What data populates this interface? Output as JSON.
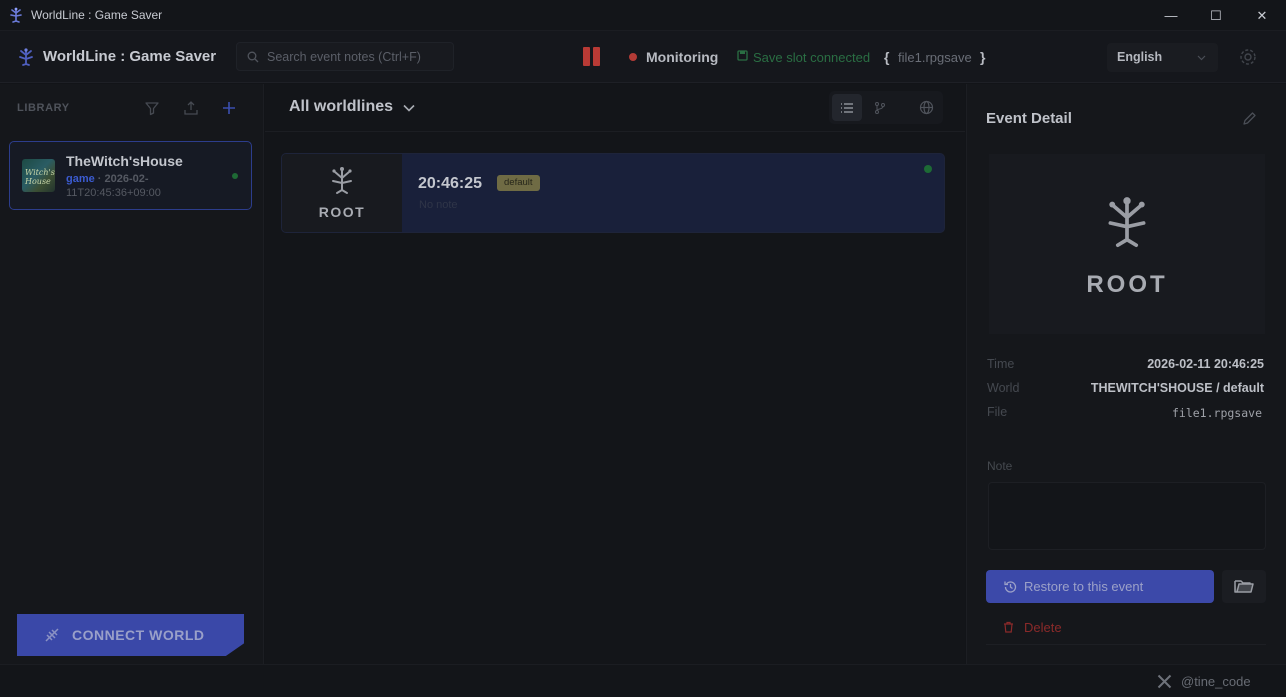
{
  "window": {
    "title": "WorldLine : Game Saver",
    "controls": {
      "minimize": "—",
      "maximize": "☐",
      "close": "✕"
    }
  },
  "header": {
    "app_name": "WorldLine : Game Saver",
    "search_placeholder": "Search event notes (Ctrl+F)",
    "monitoring_label": "Monitoring",
    "slot_status": "Save slot connected",
    "slot_brace_open": "{",
    "slot_file": "file1.rpgsave",
    "slot_brace_close": "}",
    "language": "English",
    "colors": {
      "recording": "#b33b36",
      "connected": "#2a6e43",
      "accent": "#3c49a9"
    }
  },
  "sidebar": {
    "library_label": "LIBRARY",
    "icons": [
      "filter-icon",
      "export-icon",
      "add-icon"
    ],
    "worlds": [
      {
        "name": "TheWitch'sHouse",
        "thumb_text": "Witch's House",
        "type": "game",
        "separator": " · 2026-02-",
        "time": "11T20:45:36+09:00",
        "status_color": "#1e6a35"
      }
    ],
    "connect_label": "CONNECT WORLD"
  },
  "center": {
    "worldline_select": "All worldlines",
    "view_modes": [
      "list-view-icon",
      "branch-view-icon",
      "globe-view-icon"
    ],
    "events": [
      {
        "thumb_label": "ROOT",
        "time": "20:46:25",
        "badge": "default",
        "note": "No note"
      }
    ]
  },
  "detail": {
    "title": "Event Detail",
    "image_label": "ROOT",
    "time_label": "Time",
    "time_value": "2026-02-11 20:46:25",
    "world_label": "World",
    "world_value": "THEWITCH'SHOUSE / default",
    "file_label": "File",
    "file_value": "file1.rpgsave",
    "note_label": "Note",
    "note_value": "",
    "restore_label": "Restore to this event",
    "delete_label": "Delete"
  },
  "footer": {
    "handle": "@tine_code"
  }
}
